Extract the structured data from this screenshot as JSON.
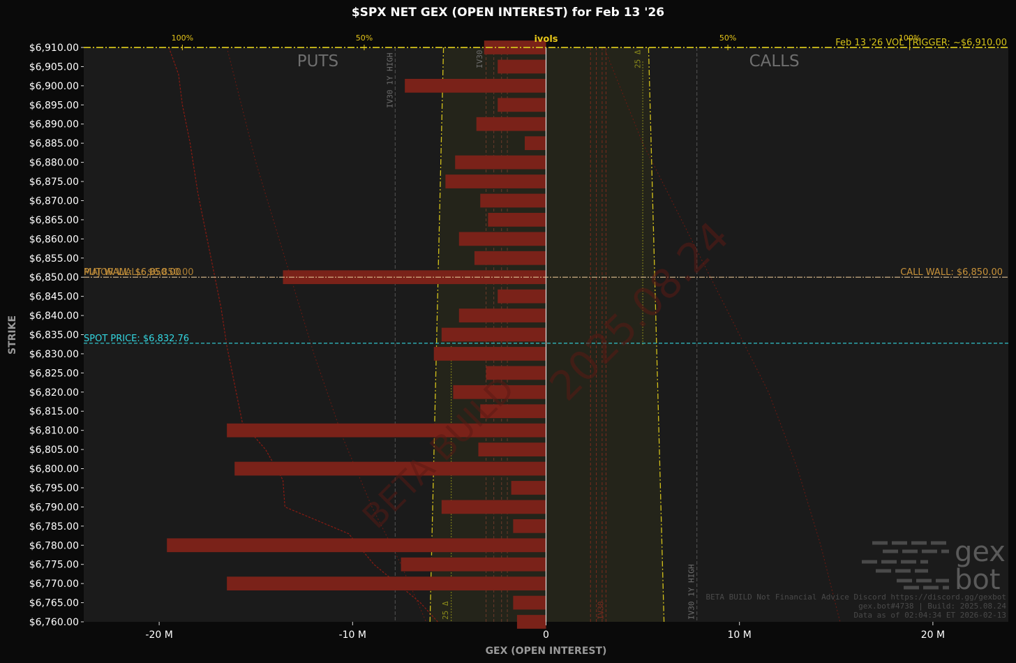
{
  "chart_data": {
    "type": "bar",
    "orientation": "horizontal",
    "title": "$SPX NET GEX (OPEN INTEREST) for Feb 13 '26",
    "xlabel": "GEX (OPEN INTEREST)",
    "ylabel": "STRIKE",
    "xlim": [
      -23.9,
      23.9
    ],
    "ylim": [
      6760,
      6910
    ],
    "x_ticks": [
      -20,
      -10,
      0,
      10,
      20
    ],
    "x_tick_labels": [
      "-20 M",
      "-10 M",
      "0",
      "10 M",
      "20 M"
    ],
    "y_tick_step": 5,
    "grid": false,
    "strikes": [
      6910,
      6905,
      6900,
      6895,
      6890,
      6885,
      6880,
      6875,
      6870,
      6865,
      6860,
      6855,
      6850,
      6845,
      6840,
      6835,
      6830,
      6825,
      6820,
      6815,
      6810,
      6805,
      6800,
      6795,
      6790,
      6785,
      6780,
      6775,
      6770,
      6765,
      6760
    ],
    "values": [
      -3.2,
      -2.5,
      -7.3,
      -2.5,
      -3.6,
      -1.1,
      -4.7,
      -5.2,
      -3.4,
      -3.0,
      -4.5,
      -3.7,
      -13.6,
      -2.5,
      -4.5,
      -5.4,
      -5.8,
      -3.1,
      -4.8,
      -3.4,
      -16.5,
      -3.5,
      -16.1,
      -1.8,
      -5.4,
      -1.7,
      -19.6,
      -7.5,
      -16.5,
      -1.7,
      -1.5
    ],
    "bar_color": "#7a2219",
    "section_labels": {
      "left": "PUTS",
      "right": "CALLS"
    },
    "ivols_axis": {
      "label": "ivols",
      "ticks": [
        "100%",
        "50%",
        "50%",
        "100%"
      ],
      "color": "#e6c619"
    },
    "levels": {
      "vol_trigger": {
        "label": "Feb 13 '26 VOL TRIGGER: ~$6,910.00",
        "value": 6910,
        "color": "#d4c21a"
      },
      "call_wall": {
        "label": "CALL WALL: $6,850.00",
        "value": 6850,
        "color": "#c8923a"
      },
      "put_wall": {
        "label": "PUT WALL: $6,850.00",
        "value": 6850,
        "color": "#c8923a"
      },
      "major_wall": {
        "label": "MAJOR WALL: $6,850.00",
        "value": 6850,
        "color": "#c8923a"
      },
      "spot_price": {
        "label": "SPOT PRICE: $6,832.76",
        "value": 6832.76,
        "color": "#33d6e0"
      }
    },
    "vertical_labels": {
      "iv30_1y_high_put": "IV30 1Y HIGH",
      "iv30_1y_high_call": "IV30 1Y HIGH",
      "iv30_top": "IV30",
      "iv30_bottom": "IV30",
      "delta25_put": "25 Δ",
      "delta25_call": "25 Δ"
    },
    "watermark": "2025.08.24",
    "watermark_beta": "BETA BUILD",
    "footer_lines": [
      "BETA BUILD Not Financial Advice Discord https://discord.gg/gexbot",
      "gex.bot#4738 | Build: 2025.08.24",
      "Data as of 02:04:34 ET 2026-02-13"
    ],
    "logo_text": [
      "gex",
      "bot"
    ]
  }
}
